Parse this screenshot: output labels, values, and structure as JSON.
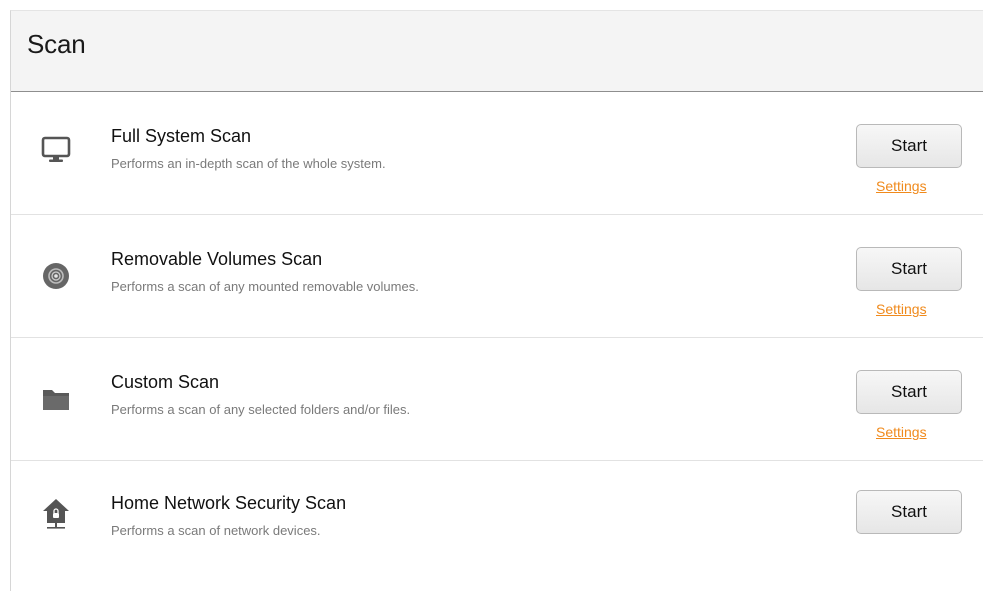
{
  "header": {
    "title": "Scan"
  },
  "scans": [
    {
      "name": "Full System Scan",
      "description": "Performs an in-depth scan of the whole system.",
      "start_label": "Start",
      "settings_label": "Settings",
      "icon": "monitor-icon"
    },
    {
      "name": "Removable Volumes Scan",
      "description": "Performs a scan of any mounted removable volumes.",
      "start_label": "Start",
      "settings_label": "Settings",
      "icon": "disc-icon"
    },
    {
      "name": "Custom Scan",
      "description": "Performs a scan of any selected folders and/or files.",
      "start_label": "Start",
      "settings_label": "Settings",
      "icon": "folder-icon"
    },
    {
      "name": "Home Network Security Scan",
      "description": "Performs a scan of network devices.",
      "start_label": "Start",
      "icon": "home-network-icon"
    }
  ],
  "colors": {
    "accent_link": "#f08a1c",
    "header_bg": "#f4f4f4",
    "icon_gray": "#555555"
  }
}
